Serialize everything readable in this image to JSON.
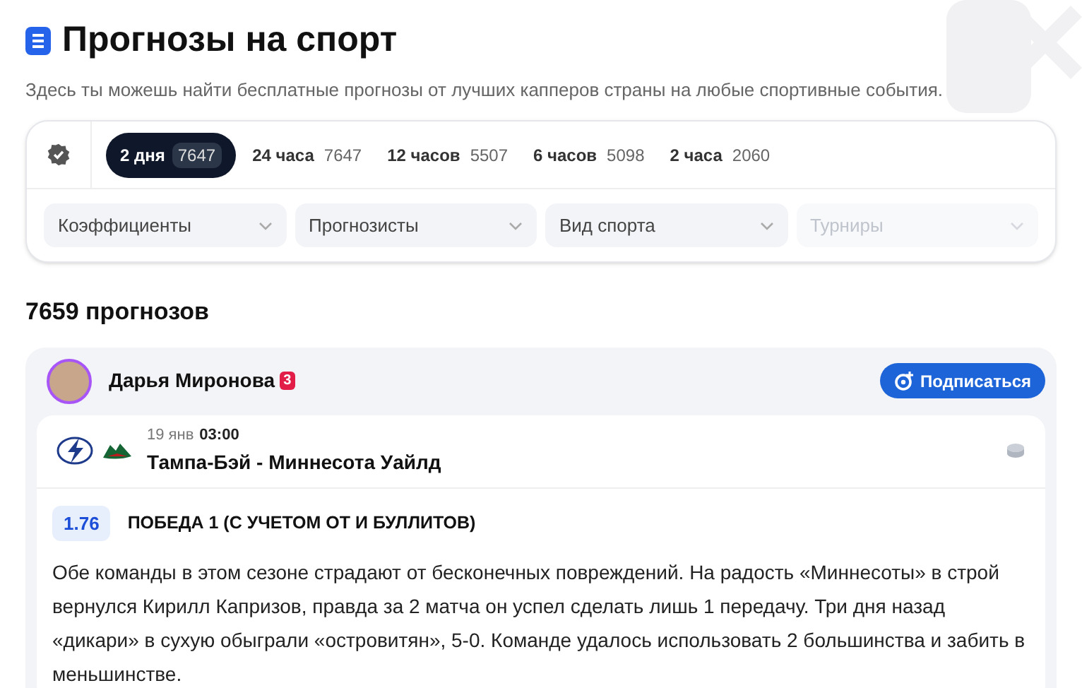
{
  "header": {
    "title": "Прогнозы на спорт",
    "subtitle": "Здесь ты можешь найти бесплатные прогнозы от лучших капперов страны на любые спортивные события."
  },
  "periods": [
    {
      "label": "2 дня",
      "count": "7647",
      "selected": true
    },
    {
      "label": "24 часа",
      "count": "7647",
      "selected": false
    },
    {
      "label": "12 часов",
      "count": "5507",
      "selected": false
    },
    {
      "label": "6 часов",
      "count": "5098",
      "selected": false
    },
    {
      "label": "2 часа",
      "count": "2060",
      "selected": false
    }
  ],
  "filters": [
    {
      "label": "Коэффициенты",
      "disabled": false
    },
    {
      "label": "Прогнозисты",
      "disabled": false
    },
    {
      "label": "Вид спорта",
      "disabled": false
    },
    {
      "label": "Турниры",
      "disabled": true
    }
  ],
  "count_title": "7659 прогнозов",
  "post": {
    "author": "Дарья Миронова",
    "author_badge": "3",
    "subscribe": "Подписаться",
    "date": "19 янв",
    "time": "03:00",
    "match": "Тампа-Бэй - Миннесота Уайлд",
    "odds": "1.76",
    "bet": "ПОБЕДА 1 (С УЧЕТОМ ОТ И БУЛЛИТОВ)",
    "text": "Обе команды в этом сезоне страдают от бесконечных повреждений. На радость «Миннесоты» в строй вернулся Кирилл Капризов, правда за 2 матча он успел сделать лишь 1 передачу. Три дня назад «дикари» в сухую обыграли «островитян», 5-0. Команде удалось использовать 2 большинства и забить в меньшинстве."
  }
}
